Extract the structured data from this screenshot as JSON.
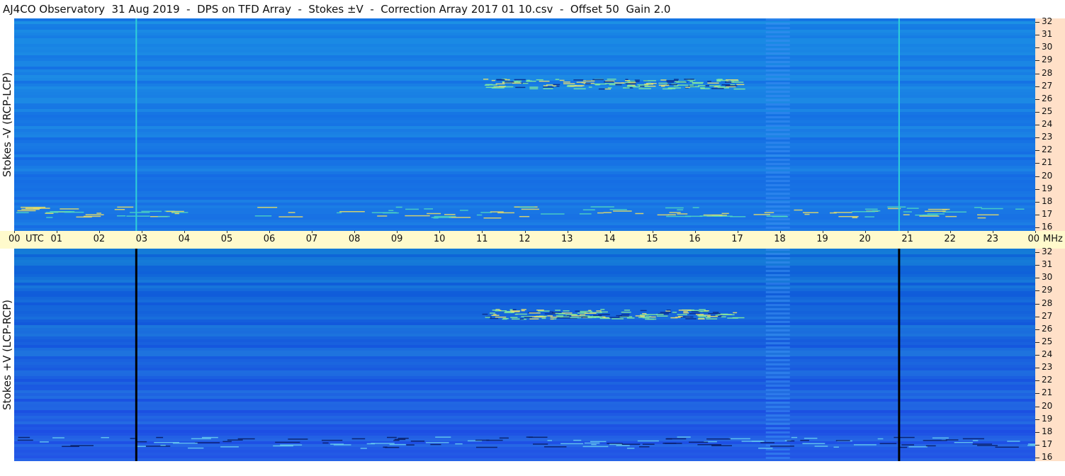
{
  "title": "AJ4CO Observatory  31 Aug 2019  -  DPS on TFD Array  -  Stokes ±V  -  Correction Array 2017 01 10.csv  -  Offset 50  Gain 2.0",
  "colors": {
    "background": "#1a73e6",
    "time_axis_bg": "#fffacc",
    "freq_axis_bg": "#ffe0c8"
  },
  "chart_data": [
    {
      "type": "heatmap",
      "panel": "upper",
      "ylabel": "Stokes -V (RCP-LCP)",
      "xlabel": "UTC",
      "x_ticks": [
        "00",
        "01",
        "02",
        "03",
        "04",
        "05",
        "06",
        "07",
        "08",
        "09",
        "10",
        "11",
        "12",
        "13",
        "14",
        "15",
        "16",
        "17",
        "18",
        "19",
        "20",
        "21",
        "22",
        "23",
        "00"
      ],
      "y_unit": "MHz",
      "y_range": [
        16,
        32
      ],
      "y_ticks": [
        "32",
        "31",
        "30",
        "29",
        "28",
        "27",
        "26",
        "25",
        "24",
        "23",
        "22",
        "21",
        "20",
        "19",
        "18",
        "17",
        "16"
      ],
      "vertical_lines_utc": [
        2.87,
        20.8
      ],
      "vertical_line_color": "#2fd0d8"
    },
    {
      "type": "heatmap",
      "panel": "lower",
      "ylabel": "Stokes +V (LCP-RCP)",
      "xlabel": "UTC",
      "x_ticks": [
        "00",
        "01",
        "02",
        "03",
        "04",
        "05",
        "06",
        "07",
        "08",
        "09",
        "10",
        "11",
        "12",
        "13",
        "14",
        "15",
        "16",
        "17",
        "18",
        "19",
        "20",
        "21",
        "22",
        "23",
        "00"
      ],
      "y_unit": "MHz",
      "y_range": [
        16,
        32
      ],
      "y_ticks": [
        "32",
        "31",
        "30",
        "29",
        "28",
        "27",
        "26",
        "25",
        "24",
        "23",
        "22",
        "21",
        "20",
        "19",
        "18",
        "17",
        "16"
      ],
      "vertical_lines_utc": [
        2.87,
        20.8
      ],
      "vertical_line_color": "#000000"
    }
  ],
  "axis": {
    "utc_label": "UTC",
    "mhz_label": "MHz"
  }
}
